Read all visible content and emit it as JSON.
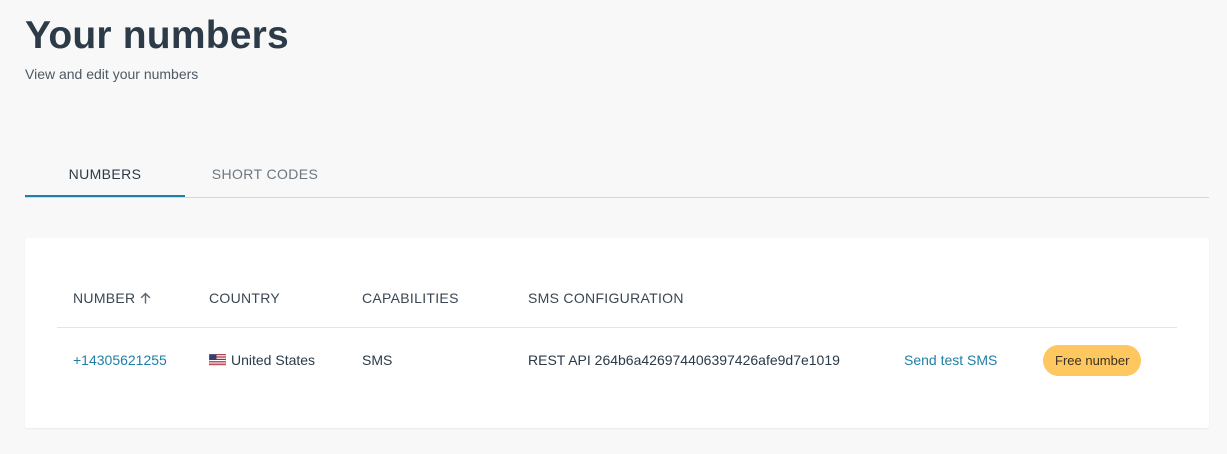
{
  "header": {
    "title": "Your numbers",
    "subtitle": "View and edit your numbers"
  },
  "tabs": [
    {
      "label": "NUMBERS",
      "active": true
    },
    {
      "label": "SHORT CODES",
      "active": false
    }
  ],
  "table": {
    "columns": [
      "NUMBER",
      "COUNTRY",
      "CAPABILITIES",
      "SMS CONFIGURATION"
    ],
    "sort_column": "NUMBER",
    "sort_icon": "arrow-up-icon",
    "rows": [
      {
        "number": "+14305621255",
        "country_flag": "us-flag-icon",
        "country": "United States",
        "capabilities": "SMS",
        "sms_configuration": "REST API 264b6a426974406397426afe9d7e1019",
        "action": "Send test SMS",
        "badge": "Free number"
      }
    ]
  },
  "colors": {
    "accent": "#1f7fa6",
    "badge": "#ffc75f",
    "background": "#f8f8f8"
  }
}
